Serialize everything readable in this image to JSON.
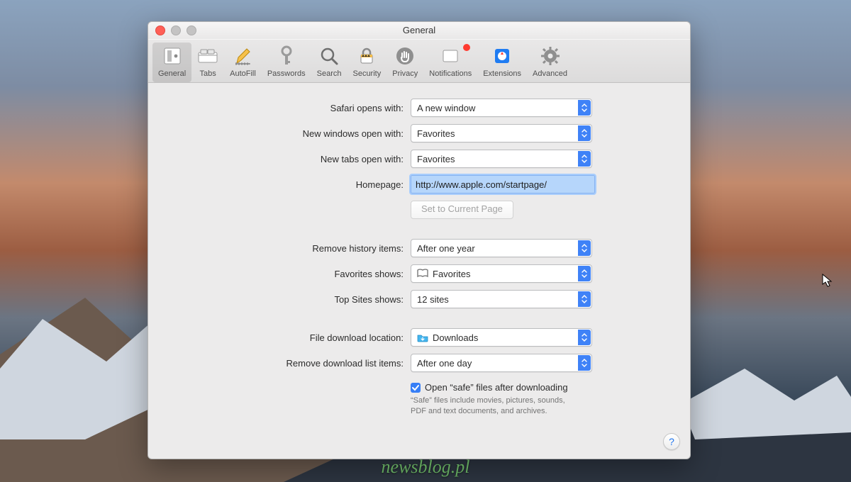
{
  "window": {
    "title": "General"
  },
  "traffic": {
    "close": "close-icon",
    "min": "minimize-icon",
    "zoom": "zoom-icon"
  },
  "toolbar": [
    {
      "id": "general",
      "label": "General",
      "selected": true
    },
    {
      "id": "tabs",
      "label": "Tabs",
      "selected": false
    },
    {
      "id": "autofill",
      "label": "AutoFill",
      "selected": false
    },
    {
      "id": "passwords",
      "label": "Passwords",
      "selected": false
    },
    {
      "id": "search",
      "label": "Search",
      "selected": false
    },
    {
      "id": "security",
      "label": "Security",
      "selected": false
    },
    {
      "id": "privacy",
      "label": "Privacy",
      "selected": false
    },
    {
      "id": "notifications",
      "label": "Notifications",
      "selected": false,
      "badge": true
    },
    {
      "id": "extensions",
      "label": "Extensions",
      "selected": false
    },
    {
      "id": "advanced",
      "label": "Advanced",
      "selected": false
    }
  ],
  "labels": {
    "safari_opens_with": "Safari opens with:",
    "new_windows_open_with": "New windows open with:",
    "new_tabs_open_with": "New tabs open with:",
    "homepage": "Homepage:",
    "set_to_current_page": "Set to Current Page",
    "remove_history_items": "Remove history items:",
    "favorites_shows": "Favorites shows:",
    "top_sites_shows": "Top Sites shows:",
    "file_download_location": "File download location:",
    "remove_download_list_items": "Remove download list items:",
    "open_safe_files": "Open “safe” files after downloading",
    "safe_help": "“Safe” files include movies, pictures, sounds, PDF and text documents, and archives."
  },
  "values": {
    "safari_opens_with": "A new window",
    "new_windows_open_with": "Favorites",
    "new_tabs_open_with": "Favorites",
    "homepage": "http://www.apple.com/startpage/",
    "remove_history_items": "After one year",
    "favorites_shows": "Favorites",
    "top_sites_shows": "12 sites",
    "file_download_location": "Downloads",
    "remove_download_list_items": "After one day",
    "open_safe_files_checked": true
  },
  "help_button": "?",
  "watermark": "newsblog.pl"
}
